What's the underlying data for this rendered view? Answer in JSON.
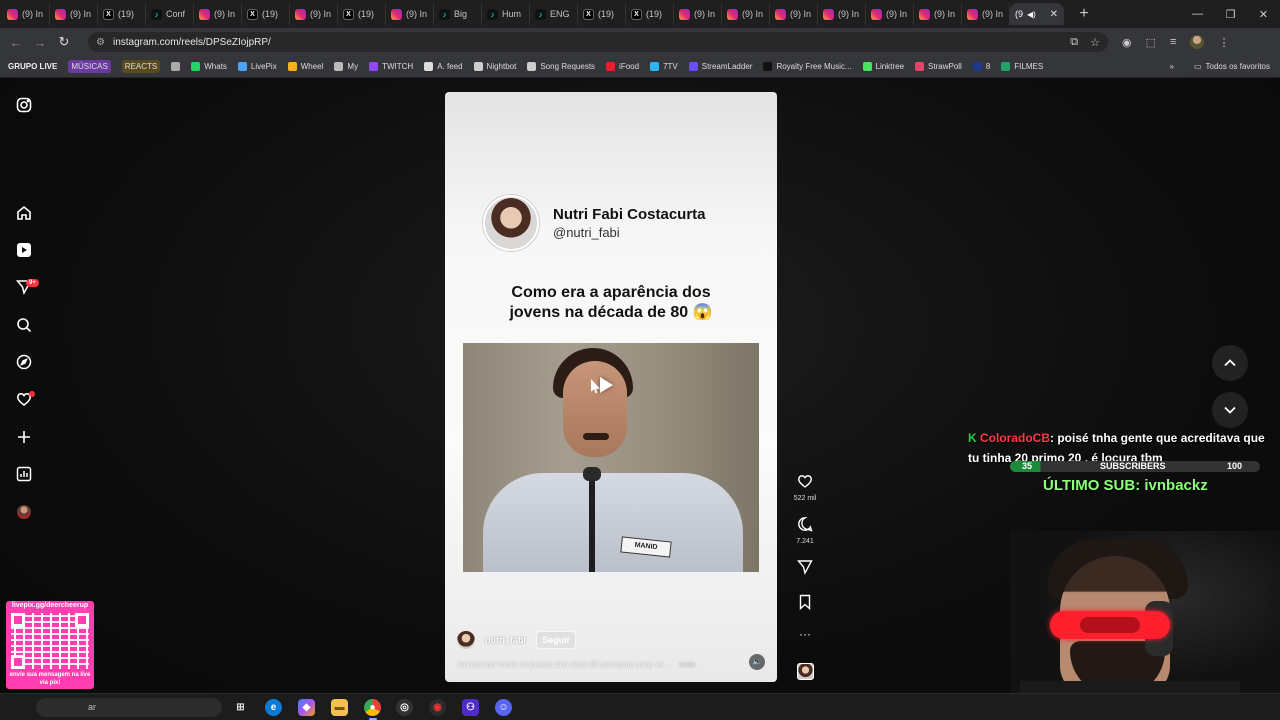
{
  "browser": {
    "tabs": [
      {
        "type": "ig",
        "label": "(9) In"
      },
      {
        "type": "ig",
        "label": "(9) In"
      },
      {
        "type": "x",
        "label": "(19)"
      },
      {
        "type": "tt",
        "label": "Conf"
      },
      {
        "type": "ig",
        "label": "(9) In"
      },
      {
        "type": "x",
        "label": "(19)"
      },
      {
        "type": "ig",
        "label": "(9) In"
      },
      {
        "type": "x",
        "label": "(19)"
      },
      {
        "type": "ig",
        "label": "(9) In"
      },
      {
        "type": "tt",
        "label": "Big"
      },
      {
        "type": "tt",
        "label": "Hum"
      },
      {
        "type": "tt",
        "label": "ENG"
      },
      {
        "type": "x",
        "label": "(19)"
      },
      {
        "type": "x",
        "label": "(19)"
      },
      {
        "type": "ig",
        "label": "(9) In"
      },
      {
        "type": "ig",
        "label": "(9) In"
      },
      {
        "type": "ig",
        "label": "(9) In"
      },
      {
        "type": "ig",
        "label": "(9) In"
      },
      {
        "type": "ig",
        "label": "(9) In"
      },
      {
        "type": "ig",
        "label": "(9) In"
      },
      {
        "type": "ig",
        "label": "(9) In"
      }
    ],
    "active_tab_label": "(9",
    "url": "instagram.com/reels/DPSeZIojpRP/",
    "bookmarks": [
      {
        "label": "GRUPO LIVE",
        "style": "strong",
        "color": ""
      },
      {
        "label": "MÚSICAS",
        "style": "chip",
        "color": "#6a3aa0"
      },
      {
        "label": "REACTS",
        "style": "chip",
        "color": "#5a4a20"
      },
      {
        "label": "",
        "style": "icon",
        "color": "#aaaaaa"
      },
      {
        "label": "Whats",
        "style": "icon",
        "color": "#25d366"
      },
      {
        "label": "LivePix",
        "style": "icon",
        "color": "#4aa3ff"
      },
      {
        "label": "Wheel",
        "style": "icon",
        "color": "#ffb020"
      },
      {
        "label": "My",
        "style": "icon",
        "color": "#bbbbbb"
      },
      {
        "label": "TWITCH",
        "style": "icon",
        "color": "#9146ff"
      },
      {
        "label": "A. feed",
        "style": "icon",
        "color": "#dddddd"
      },
      {
        "label": "Nightbot",
        "style": "icon",
        "color": "#cccccc"
      },
      {
        "label": "Song Requests",
        "style": "icon",
        "color": "#cccccc"
      },
      {
        "label": "iFood",
        "style": "icon",
        "color": "#ea1d2c"
      },
      {
        "label": "7TV",
        "style": "icon",
        "color": "#29b6f6"
      },
      {
        "label": "StreamLadder",
        "style": "icon",
        "color": "#6b4cff"
      },
      {
        "label": "Royalty Free Music...",
        "style": "icon",
        "color": "#111111"
      },
      {
        "label": "Linktree",
        "style": "icon",
        "color": "#43e55e"
      },
      {
        "label": "StrawPoll",
        "style": "icon",
        "color": "#e3446a"
      },
      {
        "label": "8",
        "style": "icon",
        "color": "#1e3a8a"
      },
      {
        "label": "FILMES",
        "style": "icon",
        "color": "#21a366"
      }
    ],
    "bookmarks_overflow": "»",
    "all_bookmarks_label": "Todos os favoritos"
  },
  "sidebar": {
    "notifications_badge": "9+"
  },
  "reel": {
    "author_name": "Nutri Fabi Costacurta",
    "author_handle": "@nutri_fabi",
    "headline_line1": "Como era a aparência dos",
    "headline_line2": "jovens na década de 80 😱",
    "shirt_tag": "MANID",
    "footer_username": "nutri_fabi",
    "follow_label": "Seguir",
    "caption": "Já reparou como os jovens dos anos 80 pareciam mais ve ...",
    "caption_more": "mais",
    "mute_icon": "🔈"
  },
  "actions": {
    "likes": "522 mil",
    "comments": "7.241"
  },
  "overlay": {
    "chat_user": "ColoradoCB",
    "chat_text": ": poisé tnha gente que acreditava que tu tinha 20 primo 20 , é locura tbm",
    "subs_current": "35",
    "subs_label": "SUBSCRIBERS",
    "subs_goal": "100",
    "subs_progress": 0.35,
    "last_sub": "ÚLTIMO SUB: ivnbackz",
    "qr_top": "livepix.gg/deercheerup",
    "qr_bottom": "envie sua mensagem na live via pix!"
  },
  "taskbar": {
    "search_text": "ar"
  }
}
